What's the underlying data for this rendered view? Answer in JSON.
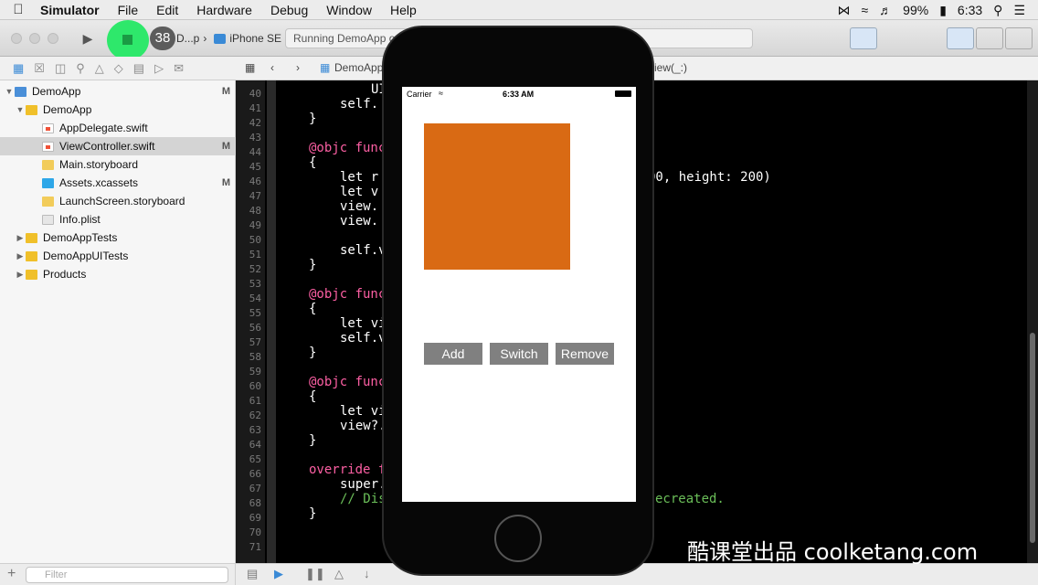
{
  "menubar": {
    "app": "Simulator",
    "items": [
      "File",
      "Edit",
      "Hardware",
      "Debug",
      "Window",
      "Help"
    ],
    "battery": "99%",
    "clock": "6:33"
  },
  "toolbar": {
    "stop_count": "38",
    "scheme": "D...p",
    "device": "iPhone SE",
    "activity": "Running DemoApp o"
  },
  "navigator": {
    "items": [
      {
        "label": "DemoApp",
        "status": "M"
      },
      {
        "label": "DemoApp",
        "status": ""
      },
      {
        "label": "AppDelegate.swift",
        "status": ""
      },
      {
        "label": "ViewController.swift",
        "status": "M"
      },
      {
        "label": "Main.storyboard",
        "status": ""
      },
      {
        "label": "Assets.xcassets",
        "status": "M"
      },
      {
        "label": "LaunchScreen.storyboard",
        "status": ""
      },
      {
        "label": "Info.plist",
        "status": ""
      },
      {
        "label": "DemoAppTests",
        "status": ""
      },
      {
        "label": "DemoAppUITests",
        "status": ""
      },
      {
        "label": "Products",
        "status": ""
      }
    ],
    "filter_placeholder": "Filter"
  },
  "jumpbar": {
    "crumb1": "DemoApp",
    "crumb_tail": "iew(_:)"
  },
  "editor": {
    "line_numbers": [
      "40",
      "41",
      "42",
      "43",
      "44",
      "45",
      "46",
      "47",
      "48",
      "49",
      "50",
      "51",
      "52",
      "53",
      "54",
      "55",
      "56",
      "57",
      "58",
      "59",
      "60",
      "61",
      "62",
      "63",
      "64",
      "65",
      "66",
      "67",
      "68",
      "69",
      "70",
      "71"
    ],
    "lines": {
      "l39": "UI",
      "l40": "self.",
      "l41": "}",
      "l43": "@objc func",
      "l44": "{",
      "l45a": "let r",
      "l45b": "00, height: 200)",
      "l46": "let v",
      "l47": "view.",
      "l48": "view.",
      "l50": "self.v",
      "l51": "}",
      "l53": "@objc func",
      "l54": "{",
      "l55": "let vi",
      "l56": "self.v",
      "l57": "}",
      "l59": "@objc func",
      "l60": "{",
      "l61": "let vi",
      "l62": "view?.",
      "l63": "}",
      "l65": "override f",
      "l66": "super.",
      "l67a": "// Dis",
      "l67b": "ecreated.",
      "l68": "}"
    }
  },
  "simulator": {
    "carrier": "Carrier",
    "time": "6:33 AM",
    "orange_color": "#d96a14",
    "buttons": [
      "Add",
      "Switch",
      "Remove"
    ]
  },
  "watermark": "酷课堂出品 coolketang.com"
}
